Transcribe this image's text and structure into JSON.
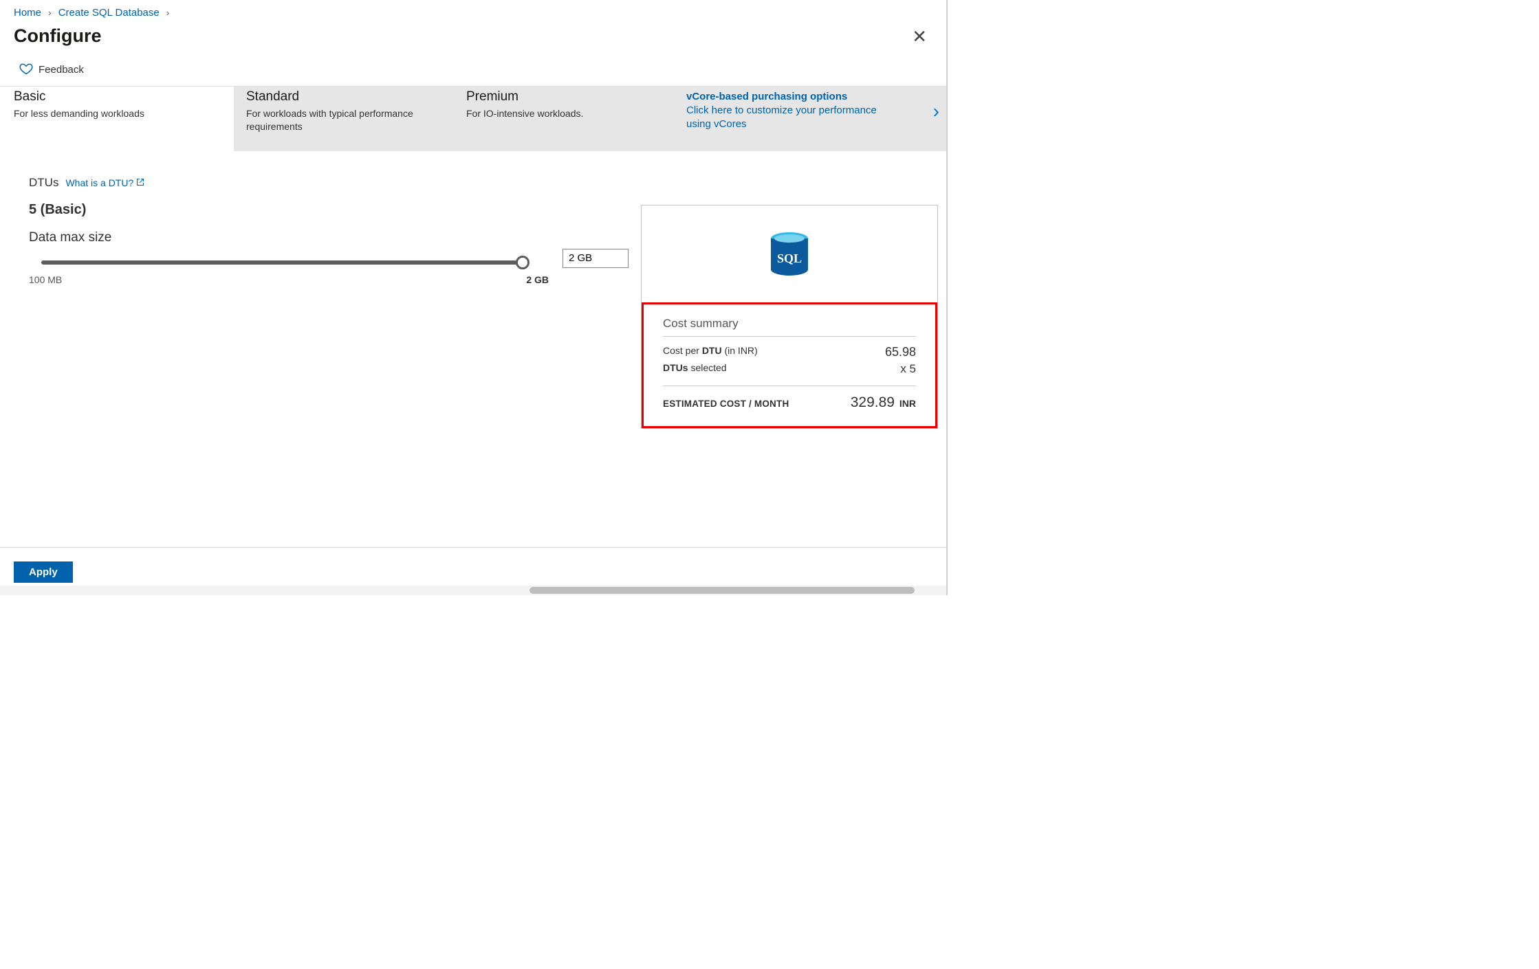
{
  "breadcrumb": {
    "home": "Home",
    "create": "Create SQL Database"
  },
  "title": "Configure",
  "feedback": "Feedback",
  "tiers": {
    "basic": {
      "name": "Basic",
      "desc": "For less demanding workloads"
    },
    "standard": {
      "name": "Standard",
      "desc": "For workloads with typical performance requirements"
    },
    "premium": {
      "name": "Premium",
      "desc": "For IO-intensive workloads."
    },
    "vcore": {
      "heading": "vCore-based purchasing options",
      "text": "Click here to customize your performance using vCores"
    }
  },
  "dtus": {
    "label": "DTUs",
    "link": "What is a DTU?",
    "value": "5 (Basic)"
  },
  "datamax": {
    "label": "Data max size",
    "min": "100 MB",
    "max": "2 GB",
    "current": "2 GB"
  },
  "cost": {
    "title": "Cost summary",
    "perDtuLabelPrefix": "Cost per ",
    "perDtuLabelBold": "DTU",
    "perDtuLabelSuffix": " (in INR)",
    "perDtuValue": "65.98",
    "dtusSelectedBold": "DTUs",
    "dtusSelectedSuffix": " selected",
    "dtusSelectedValue": "x 5",
    "estLabel": "ESTIMATED COST / MONTH",
    "estValue": "329.89",
    "estCurrency": "INR"
  },
  "footer": {
    "apply": "Apply"
  }
}
